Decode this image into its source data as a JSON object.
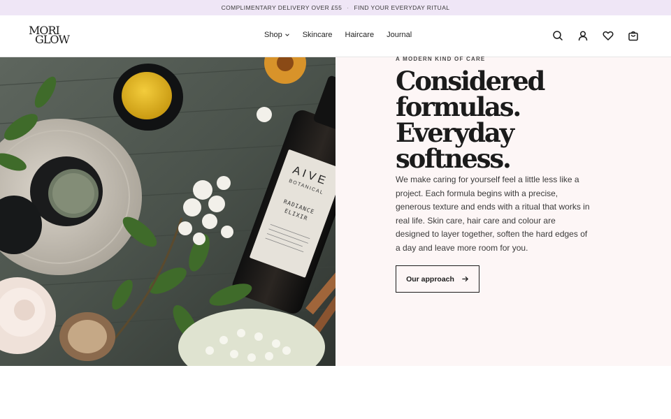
{
  "announcement": {
    "left": "COMPLIMENTARY DELIVERY OVER £55",
    "separator": "·",
    "right": "FIND YOUR EVERYDAY RITUAL"
  },
  "brand": {
    "line1": "MORI",
    "line2": "GLOW"
  },
  "nav": {
    "items": [
      {
        "label": "Shop",
        "icon": "chevron-down-icon"
      },
      {
        "label": "Skincare"
      },
      {
        "label": "Haircare"
      },
      {
        "label": "Journal"
      }
    ]
  },
  "header_icons": [
    "search-icon",
    "account-icon",
    "heart-icon",
    "bag-icon"
  ],
  "hero": {
    "image": {
      "bottle_brand_line1": "AIVE",
      "bottle_brand_line2": "BOTANICAL",
      "bottle_product_line1": "RADIANCE",
      "bottle_product_line2": "ELIXIR"
    },
    "eyebrow": "A MODERN KIND OF CARE",
    "headline": [
      "Considered",
      "formulas.",
      "Everyday",
      "softness."
    ],
    "body": "We make caring for yourself feel a little less like a project. Each formula begins with a precise, generous texture and ends with a ritual that works in real life. Skin care, hair care and colour are designed to layer together, soften the hard edges of a day and leave more room for you.",
    "cta_label": "Our approach",
    "cta_icon": "arrow-right-icon"
  },
  "colors": {
    "announcement_bg": "#efe6f6",
    "hero_copy_bg": "#fdf6f6",
    "text_dark": "#1b1b1b"
  }
}
